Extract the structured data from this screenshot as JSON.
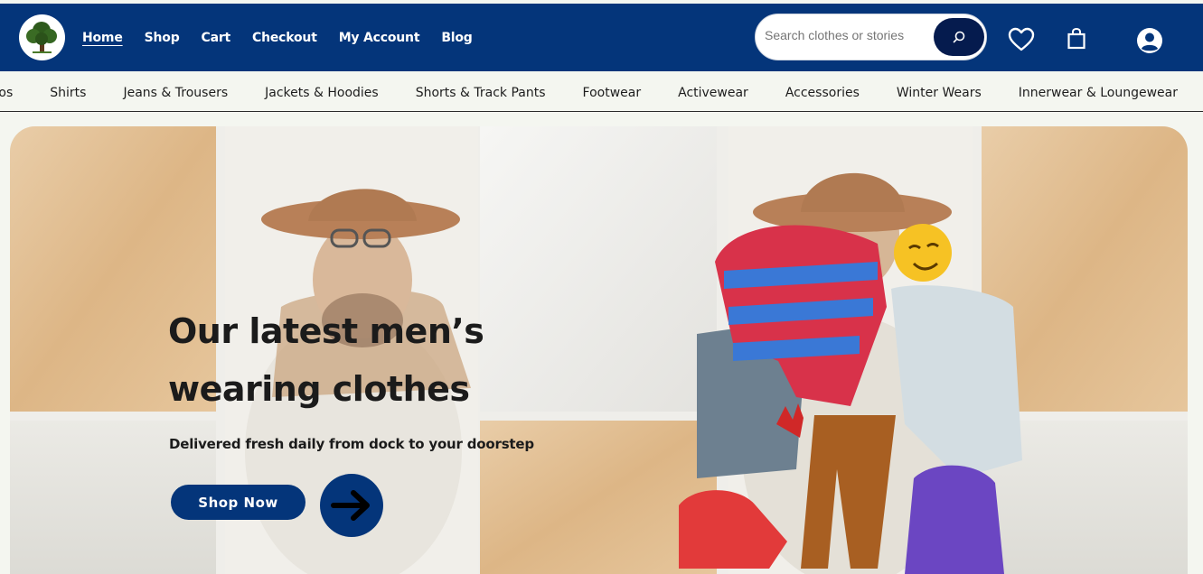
{
  "header": {
    "nav": [
      "Home",
      "Shop",
      "Cart",
      "Checkout",
      "My Account",
      "Blog"
    ],
    "search_placeholder": "Search clothes or stories"
  },
  "categories": [
    "Polos",
    "Shirts",
    "Jeans & Trousers",
    "Jackets & Hoodies",
    "Shorts & Track Pants",
    "Footwear",
    "Activewear",
    "Accessories",
    "Winter Wears",
    "Innerwear & Loungewear"
  ],
  "hero": {
    "headline_1": "Our latest men’s",
    "headline_2": "wearing clothes",
    "subline": "Delivered fresh daily from dock to your doorstep",
    "cta": "Shop Now"
  },
  "icons": [
    "tree-logo-icon",
    "search-icon",
    "heart-icon",
    "shopping-bag-icon",
    "user-account-icon",
    "arrow-right-icon"
  ],
  "colors": {
    "brand": "#04357a",
    "dark_button": "#051b4e",
    "background": "#f4f6f0"
  }
}
